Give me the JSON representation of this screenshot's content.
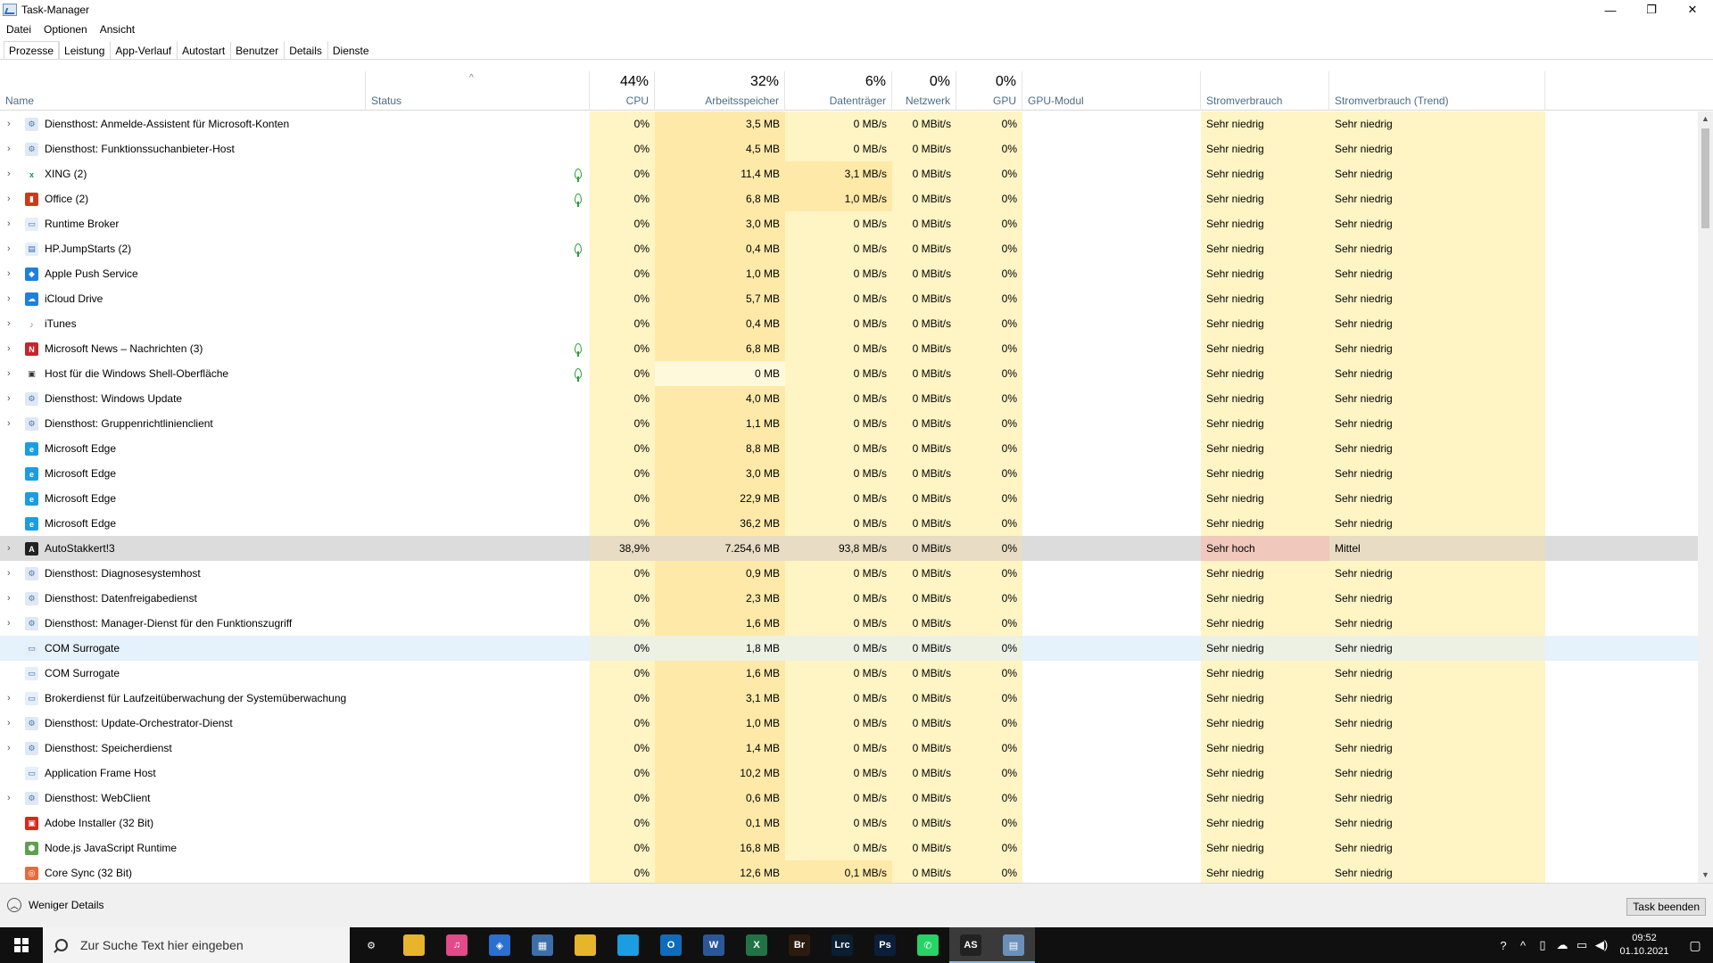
{
  "window": {
    "title": "Task-Manager",
    "controls": [
      "—",
      "❐",
      "✕"
    ]
  },
  "menu": [
    "Datei",
    "Optionen",
    "Ansicht"
  ],
  "tabs": [
    "Prozesse",
    "Leistung",
    "App-Verlauf",
    "Autostart",
    "Benutzer",
    "Details",
    "Dienste"
  ],
  "columns": {
    "name": "Name",
    "status": "Status",
    "cpu": {
      "pct": "44%",
      "label": "CPU"
    },
    "mem": {
      "pct": "32%",
      "label": "Arbeitsspeicher"
    },
    "disk": {
      "pct": "6%",
      "label": "Datenträger"
    },
    "net": {
      "pct": "0%",
      "label": "Netzwerk"
    },
    "gpu": {
      "pct": "0%",
      "label": "GPU"
    },
    "gpumod": "GPU-Modul",
    "power": "Stromverbrauch",
    "powertrend": "Stromverbrauch (Trend)"
  },
  "rows": [
    {
      "name": "Diensthost: Anmelde-Assistent für Microsoft-Konten",
      "icon": "gear-icon",
      "expand": true,
      "leaf": false,
      "cpu": "0%",
      "mem": "3,5 MB",
      "disk": "0 MB/s",
      "net": "0 MBit/s",
      "gpu": "0%",
      "power": "Sehr niedrig",
      "trend": "Sehr niedrig"
    },
    {
      "name": "Diensthost: Funktionssuchanbieter-Host",
      "icon": "gear-icon",
      "expand": true,
      "leaf": false,
      "cpu": "0%",
      "mem": "4,5 MB",
      "disk": "0 MB/s",
      "net": "0 MBit/s",
      "gpu": "0%",
      "power": "Sehr niedrig",
      "trend": "Sehr niedrig"
    },
    {
      "name": "XING (2)",
      "icon": "xing-icon",
      "expand": true,
      "leaf": true,
      "cpu": "0%",
      "mem": "11,4 MB",
      "disk": "3,1 MB/s",
      "net": "0 MBit/s",
      "gpu": "0%",
      "power": "Sehr niedrig",
      "trend": "Sehr niedrig"
    },
    {
      "name": "Office (2)",
      "icon": "office-icon",
      "expand": true,
      "leaf": true,
      "cpu": "0%",
      "mem": "6,8 MB",
      "disk": "1,0 MB/s",
      "net": "0 MBit/s",
      "gpu": "0%",
      "power": "Sehr niedrig",
      "trend": "Sehr niedrig"
    },
    {
      "name": "Runtime Broker",
      "icon": "window-icon",
      "expand": true,
      "leaf": false,
      "cpu": "0%",
      "mem": "3,0 MB",
      "disk": "0 MB/s",
      "net": "0 MBit/s",
      "gpu": "0%",
      "power": "Sehr niedrig",
      "trend": "Sehr niedrig"
    },
    {
      "name": "HP.JumpStarts (2)",
      "icon": "hp-icon",
      "expand": true,
      "leaf": true,
      "cpu": "0%",
      "mem": "0,4 MB",
      "disk": "0 MB/s",
      "net": "0 MBit/s",
      "gpu": "0%",
      "power": "Sehr niedrig",
      "trend": "Sehr niedrig"
    },
    {
      "name": "Apple Push Service",
      "icon": "apple-push-icon",
      "expand": true,
      "leaf": false,
      "cpu": "0%",
      "mem": "1,0 MB",
      "disk": "0 MB/s",
      "net": "0 MBit/s",
      "gpu": "0%",
      "power": "Sehr niedrig",
      "trend": "Sehr niedrig"
    },
    {
      "name": "iCloud Drive",
      "icon": "icloud-icon",
      "expand": true,
      "leaf": false,
      "cpu": "0%",
      "mem": "5,7 MB",
      "disk": "0 MB/s",
      "net": "0 MBit/s",
      "gpu": "0%",
      "power": "Sehr niedrig",
      "trend": "Sehr niedrig"
    },
    {
      "name": "iTunes",
      "icon": "itunes-icon",
      "expand": true,
      "leaf": false,
      "cpu": "0%",
      "mem": "0,4 MB",
      "disk": "0 MB/s",
      "net": "0 MBit/s",
      "gpu": "0%",
      "power": "Sehr niedrig",
      "trend": "Sehr niedrig"
    },
    {
      "name": "Microsoft News – Nachrichten (3)",
      "icon": "news-icon",
      "expand": true,
      "leaf": true,
      "cpu": "0%",
      "mem": "6,8 MB",
      "disk": "0 MB/s",
      "net": "0 MBit/s",
      "gpu": "0%",
      "power": "Sehr niedrig",
      "trend": "Sehr niedrig"
    },
    {
      "name": "Host für die Windows Shell-Oberfläche",
      "icon": "shell-icon",
      "expand": true,
      "leaf": true,
      "cpu": "0%",
      "mem": "0 MB",
      "disk": "0 MB/s",
      "net": "0 MBit/s",
      "gpu": "0%",
      "power": "Sehr niedrig",
      "trend": "Sehr niedrig"
    },
    {
      "name": "Diensthost: Windows Update",
      "icon": "gear-icon",
      "expand": true,
      "leaf": false,
      "cpu": "0%",
      "mem": "4,0 MB",
      "disk": "0 MB/s",
      "net": "0 MBit/s",
      "gpu": "0%",
      "power": "Sehr niedrig",
      "trend": "Sehr niedrig"
    },
    {
      "name": "Diensthost: Gruppenrichtlinienclient",
      "icon": "gear-icon",
      "expand": true,
      "leaf": false,
      "cpu": "0%",
      "mem": "1,1 MB",
      "disk": "0 MB/s",
      "net": "0 MBit/s",
      "gpu": "0%",
      "power": "Sehr niedrig",
      "trend": "Sehr niedrig"
    },
    {
      "name": "Microsoft Edge",
      "icon": "edge-icon",
      "expand": false,
      "leaf": false,
      "cpu": "0%",
      "mem": "8,8 MB",
      "disk": "0 MB/s",
      "net": "0 MBit/s",
      "gpu": "0%",
      "power": "Sehr niedrig",
      "trend": "Sehr niedrig"
    },
    {
      "name": "Microsoft Edge",
      "icon": "edge-icon",
      "expand": false,
      "leaf": false,
      "cpu": "0%",
      "mem": "3,0 MB",
      "disk": "0 MB/s",
      "net": "0 MBit/s",
      "gpu": "0%",
      "power": "Sehr niedrig",
      "trend": "Sehr niedrig"
    },
    {
      "name": "Microsoft Edge",
      "icon": "edge-icon",
      "expand": false,
      "leaf": false,
      "cpu": "0%",
      "mem": "22,9 MB",
      "disk": "0 MB/s",
      "net": "0 MBit/s",
      "gpu": "0%",
      "power": "Sehr niedrig",
      "trend": "Sehr niedrig"
    },
    {
      "name": "Microsoft Edge",
      "icon": "edge-icon",
      "expand": false,
      "leaf": false,
      "cpu": "0%",
      "mem": "36,2 MB",
      "disk": "0 MB/s",
      "net": "0 MBit/s",
      "gpu": "0%",
      "power": "Sehr niedrig",
      "trend": "Sehr niedrig"
    },
    {
      "name": "AutoStakkert!3",
      "icon": "autostakkert-icon",
      "expand": true,
      "leaf": false,
      "cpu": "38,9%",
      "mem": "7.254,6 MB",
      "disk": "93,8 MB/s",
      "net": "0 MBit/s",
      "gpu": "0%",
      "power": "Sehr hoch",
      "trend": "Mittel",
      "state": "highlight"
    },
    {
      "name": "Diensthost: Diagnosesystemhost",
      "icon": "gear-icon",
      "expand": true,
      "leaf": false,
      "cpu": "0%",
      "mem": "0,9 MB",
      "disk": "0 MB/s",
      "net": "0 MBit/s",
      "gpu": "0%",
      "power": "Sehr niedrig",
      "trend": "Sehr niedrig"
    },
    {
      "name": "Diensthost: Datenfreigabedienst",
      "icon": "gear-icon",
      "expand": true,
      "leaf": false,
      "cpu": "0%",
      "mem": "2,3 MB",
      "disk": "0 MB/s",
      "net": "0 MBit/s",
      "gpu": "0%",
      "power": "Sehr niedrig",
      "trend": "Sehr niedrig"
    },
    {
      "name": "Diensthost: Manager-Dienst für den Funktionszugriff",
      "icon": "gear-icon",
      "expand": true,
      "leaf": false,
      "cpu": "0%",
      "mem": "1,6 MB",
      "disk": "0 MB/s",
      "net": "0 MBit/s",
      "gpu": "0%",
      "power": "Sehr niedrig",
      "trend": "Sehr niedrig"
    },
    {
      "name": "COM Surrogate",
      "icon": "window-icon",
      "expand": false,
      "leaf": false,
      "cpu": "0%",
      "mem": "1,8 MB",
      "disk": "0 MB/s",
      "net": "0 MBit/s",
      "gpu": "0%",
      "power": "Sehr niedrig",
      "trend": "Sehr niedrig",
      "state": "selected"
    },
    {
      "name": "COM Surrogate",
      "icon": "window-icon",
      "expand": false,
      "leaf": false,
      "cpu": "0%",
      "mem": "1,6 MB",
      "disk": "0 MB/s",
      "net": "0 MBit/s",
      "gpu": "0%",
      "power": "Sehr niedrig",
      "trend": "Sehr niedrig"
    },
    {
      "name": "Brokerdienst für Laufzeitüberwachung der Systemüberwachung",
      "icon": "window-icon",
      "expand": true,
      "leaf": false,
      "cpu": "0%",
      "mem": "3,1 MB",
      "disk": "0 MB/s",
      "net": "0 MBit/s",
      "gpu": "0%",
      "power": "Sehr niedrig",
      "trend": "Sehr niedrig"
    },
    {
      "name": "Diensthost: Update-Orchestrator-Dienst",
      "icon": "gear-icon",
      "expand": true,
      "leaf": false,
      "cpu": "0%",
      "mem": "1,0 MB",
      "disk": "0 MB/s",
      "net": "0 MBit/s",
      "gpu": "0%",
      "power": "Sehr niedrig",
      "trend": "Sehr niedrig"
    },
    {
      "name": "Diensthost: Speicherdienst",
      "icon": "gear-icon",
      "expand": true,
      "leaf": false,
      "cpu": "0%",
      "mem": "1,4 MB",
      "disk": "0 MB/s",
      "net": "0 MBit/s",
      "gpu": "0%",
      "power": "Sehr niedrig",
      "trend": "Sehr niedrig"
    },
    {
      "name": "Application Frame Host",
      "icon": "window-icon",
      "expand": false,
      "leaf": false,
      "cpu": "0%",
      "mem": "10,2 MB",
      "disk": "0 MB/s",
      "net": "0 MBit/s",
      "gpu": "0%",
      "power": "Sehr niedrig",
      "trend": "Sehr niedrig"
    },
    {
      "name": "Diensthost: WebClient",
      "icon": "gear-icon",
      "expand": true,
      "leaf": false,
      "cpu": "0%",
      "mem": "0,6 MB",
      "disk": "0 MB/s",
      "net": "0 MBit/s",
      "gpu": "0%",
      "power": "Sehr niedrig",
      "trend": "Sehr niedrig"
    },
    {
      "name": "Adobe Installer (32 Bit)",
      "icon": "adobe-installer-icon",
      "expand": false,
      "leaf": false,
      "cpu": "0%",
      "mem": "0,1 MB",
      "disk": "0 MB/s",
      "net": "0 MBit/s",
      "gpu": "0%",
      "power": "Sehr niedrig",
      "trend": "Sehr niedrig"
    },
    {
      "name": "Node.js JavaScript Runtime",
      "icon": "nodejs-icon",
      "expand": false,
      "leaf": false,
      "cpu": "0%",
      "mem": "16,8 MB",
      "disk": "0 MB/s",
      "net": "0 MBit/s",
      "gpu": "0%",
      "power": "Sehr niedrig",
      "trend": "Sehr niedrig"
    },
    {
      "name": "Core Sync (32 Bit)",
      "icon": "core-sync-icon",
      "expand": false,
      "leaf": false,
      "cpu": "0%",
      "mem": "12,6 MB",
      "disk": "0,1 MB/s",
      "net": "0 MBit/s",
      "gpu": "0%",
      "power": "Sehr niedrig",
      "trend": "Sehr niedrig"
    }
  ],
  "footer": {
    "fewer_details": "Weniger Details",
    "end_task": "Task beenden"
  },
  "taskbar": {
    "search_placeholder": "Zur Suche Text hier eingeben",
    "apps": [
      {
        "name": "settings-icon",
        "glyph": "⚙",
        "color": "#101010"
      },
      {
        "name": "file-explorer-pin-icon",
        "glyph": "",
        "color": "#e8b42c"
      },
      {
        "name": "itunes-icon",
        "glyph": "♫",
        "color": "#e24a8a"
      },
      {
        "name": "vpn-shield-icon",
        "glyph": "◈",
        "color": "#2a6fd1"
      },
      {
        "name": "calculator-icon",
        "glyph": "▦",
        "color": "#3c6fa8"
      },
      {
        "name": "folder-icon",
        "glyph": "",
        "color": "#e8b42c"
      },
      {
        "name": "edge-icon",
        "glyph": "",
        "color": "#1b9de2"
      },
      {
        "name": "outlook-icon",
        "glyph": "O",
        "color": "#0f6cbd"
      },
      {
        "name": "word-icon",
        "glyph": "W",
        "color": "#2b579a"
      },
      {
        "name": "excel-icon",
        "glyph": "X",
        "color": "#217346"
      },
      {
        "name": "bridge-icon",
        "glyph": "Br",
        "color": "#2b1b0e"
      },
      {
        "name": "lightroom-classic-icon",
        "glyph": "Lrc",
        "color": "#0b1f33"
      },
      {
        "name": "photoshop-icon",
        "glyph": "Ps",
        "color": "#0b1f3a"
      },
      {
        "name": "whatsapp-icon",
        "glyph": "✆",
        "color": "#25d366"
      },
      {
        "name": "autostakkert-icon",
        "glyph": "AS",
        "color": "#222"
      },
      {
        "name": "task-manager-icon",
        "glyph": "▤",
        "color": "#6b8fb8"
      }
    ],
    "clock_time": "09:52",
    "clock_date": "01.10.2021"
  },
  "colors": {
    "cell_yellow": "#fff4c4",
    "cell_yellow_strong": "#ffe9a8",
    "highlight_row": "#dcdcdc",
    "power_high": "#f0c8bc",
    "selected_row": "#e5f1fb",
    "taskbar": "#101010"
  }
}
